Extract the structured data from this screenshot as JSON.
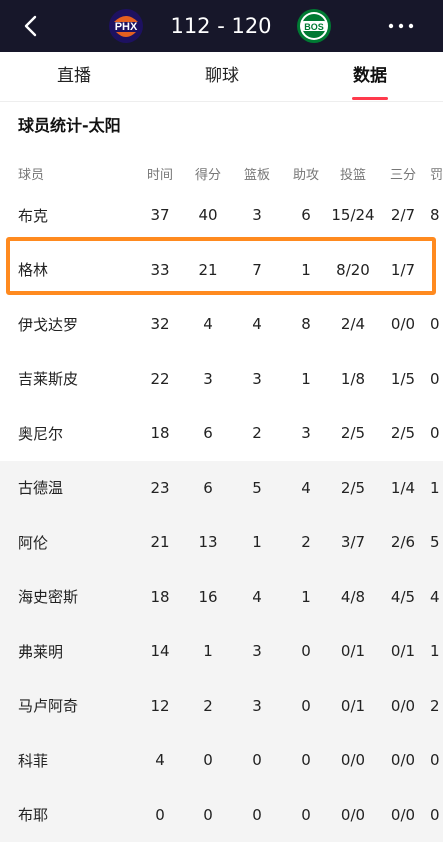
{
  "header": {
    "home_abbr": "PHX",
    "away_abbr": "BOS",
    "score": "112 - 120",
    "colors": {
      "bar": "#17172a",
      "phx": "#e56020",
      "bos": "#007a33",
      "accent": "#ff3a4c",
      "highlight": "#ff8a1f"
    }
  },
  "tabs": [
    {
      "label": "直播"
    },
    {
      "label": "聊球"
    },
    {
      "label": "数据",
      "active": true
    }
  ],
  "section_title": "球员统计-太阳",
  "columns": [
    "球员",
    "时间",
    "得分",
    "篮板",
    "助攻",
    "投篮",
    "三分",
    "罚"
  ],
  "rows": [
    {
      "name": "布克",
      "min": "37",
      "pts": "40",
      "reb": "3",
      "ast": "6",
      "fg": "15/24",
      "tp": "2/7",
      "ft": "8"
    },
    {
      "name": "格林",
      "min": "33",
      "pts": "21",
      "reb": "7",
      "ast": "1",
      "fg": "8/20",
      "tp": "1/7",
      "ft": ""
    },
    {
      "name": "伊戈达罗",
      "min": "32",
      "pts": "4",
      "reb": "4",
      "ast": "8",
      "fg": "2/4",
      "tp": "0/0",
      "ft": "0"
    },
    {
      "name": "吉莱斯皮",
      "min": "22",
      "pts": "3",
      "reb": "3",
      "ast": "1",
      "fg": "1/8",
      "tp": "1/5",
      "ft": "0"
    },
    {
      "name": "奥尼尔",
      "min": "18",
      "pts": "6",
      "reb": "2",
      "ast": "3",
      "fg": "2/5",
      "tp": "2/5",
      "ft": "0"
    },
    {
      "name": "古德温",
      "min": "23",
      "pts": "6",
      "reb": "5",
      "ast": "4",
      "fg": "2/5",
      "tp": "1/4",
      "ft": "1"
    },
    {
      "name": "阿伦",
      "min": "21",
      "pts": "13",
      "reb": "1",
      "ast": "2",
      "fg": "3/7",
      "tp": "2/6",
      "ft": "5"
    },
    {
      "name": "海史密斯",
      "min": "18",
      "pts": "16",
      "reb": "4",
      "ast": "1",
      "fg": "4/8",
      "tp": "4/5",
      "ft": "4"
    },
    {
      "name": "弗莱明",
      "min": "14",
      "pts": "1",
      "reb": "3",
      "ast": "0",
      "fg": "0/1",
      "tp": "0/1",
      "ft": "1"
    },
    {
      "name": "马卢阿奇",
      "min": "12",
      "pts": "2",
      "reb": "3",
      "ast": "0",
      "fg": "0/1",
      "tp": "0/0",
      "ft": "2"
    },
    {
      "name": "科菲",
      "min": "4",
      "pts": "0",
      "reb": "0",
      "ast": "0",
      "fg": "0/0",
      "tp": "0/0",
      "ft": "0"
    },
    {
      "name": "布耶",
      "min": "0",
      "pts": "0",
      "reb": "0",
      "ast": "0",
      "fg": "0/0",
      "tp": "0/0",
      "ft": "0"
    }
  ]
}
